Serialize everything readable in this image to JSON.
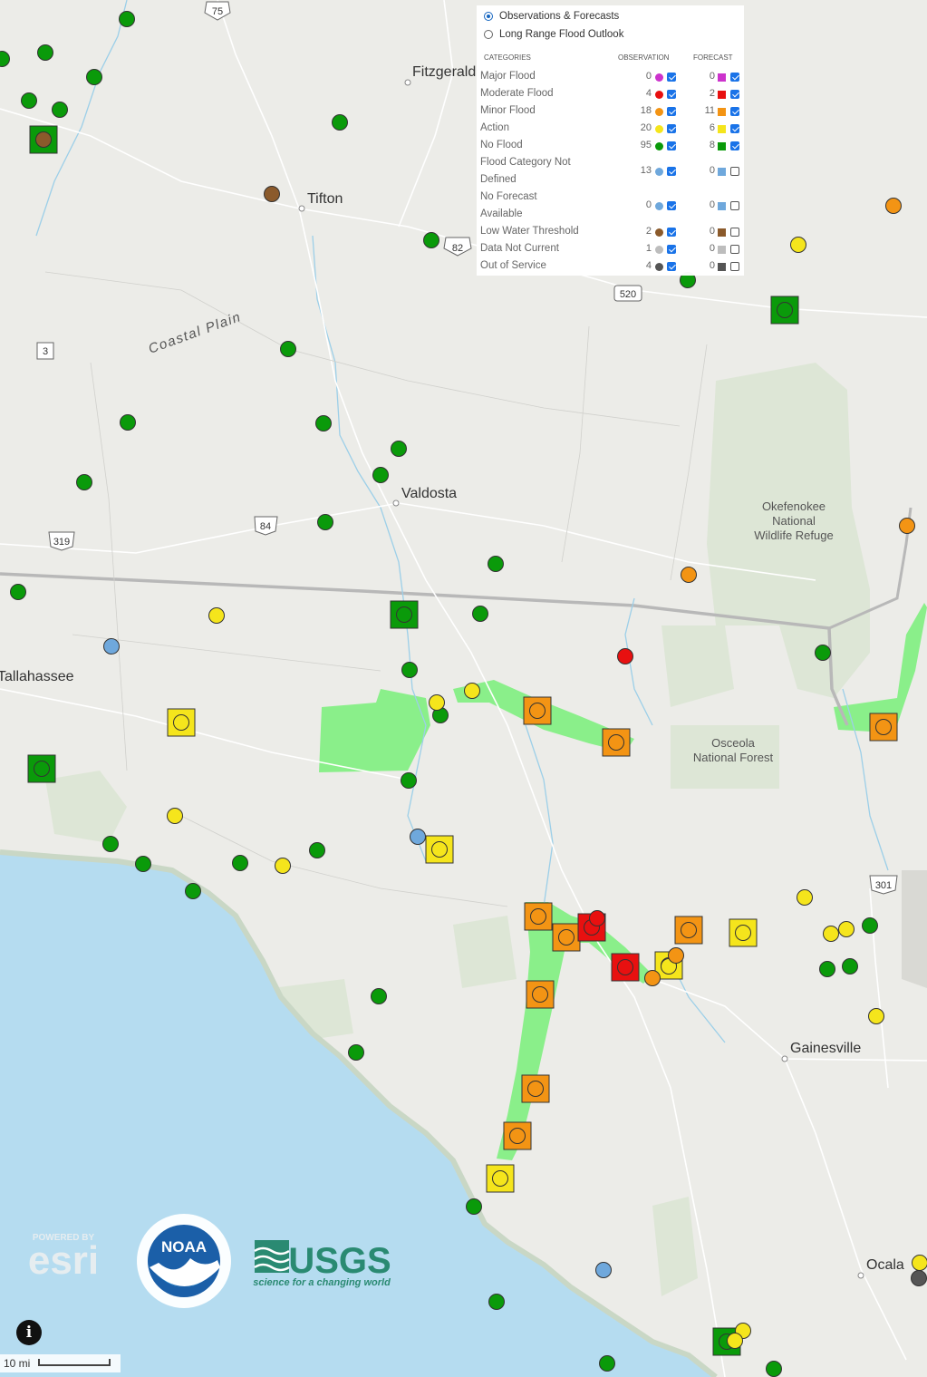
{
  "legend": {
    "modes": [
      {
        "label": "Observations & Forecasts",
        "selected": true
      },
      {
        "label": "Long Range Flood Outlook",
        "selected": false
      }
    ],
    "headers": {
      "categories": "CATEGORIES",
      "observation": "OBSERVATION",
      "forecast": "FORECAST"
    },
    "rows": [
      {
        "label": [
          "Major Flood"
        ],
        "obs": "0",
        "obs_checked": true,
        "fc": "0",
        "fc_checked": true,
        "color": "#cc33cc"
      },
      {
        "label": [
          "Moderate Flood"
        ],
        "obs": "4",
        "obs_checked": true,
        "fc": "2",
        "fc_checked": true,
        "color": "#e81010"
      },
      {
        "label": [
          "Minor Flood"
        ],
        "obs": "18",
        "obs_checked": true,
        "fc": "11",
        "fc_checked": true,
        "color": "#f39414"
      },
      {
        "label": [
          "Action"
        ],
        "obs": "20",
        "obs_checked": true,
        "fc": "6",
        "fc_checked": true,
        "color": "#f5e51c"
      },
      {
        "label": [
          "No Flood"
        ],
        "obs": "95",
        "obs_checked": true,
        "fc": "8",
        "fc_checked": true,
        "color": "#0a9a0a"
      },
      {
        "label": [
          "Flood Category Not",
          "Defined"
        ],
        "obs": "13",
        "obs_checked": true,
        "fc": "0",
        "fc_checked": false,
        "color": "#6fa8dc"
      },
      {
        "label": [
          "No Forecast",
          "Available"
        ],
        "obs": "0",
        "obs_checked": true,
        "fc": "0",
        "fc_checked": false,
        "color": "#6fa8dc"
      },
      {
        "label": [
          "Low Water Threshold"
        ],
        "obs": "2",
        "obs_checked": true,
        "fc": "0",
        "fc_checked": false,
        "color": "#8b5a2b"
      },
      {
        "label": [
          "Data Not Current"
        ],
        "obs": "1",
        "obs_checked": true,
        "fc": "0",
        "fc_checked": false,
        "color": "#bdbdbd"
      },
      {
        "label": [
          "Out of Service"
        ],
        "obs": "4",
        "obs_checked": true,
        "fc": "0",
        "fc_checked": false,
        "color": "#555555"
      }
    ]
  },
  "places": {
    "fitzgerald": "Fitzgerald",
    "tifton": "Tifton",
    "valdosta": "Valdosta",
    "tallahassee": "Tallahassee",
    "gainesville": "Gainesville",
    "ocala": "Ocala",
    "coastal_plain": "Coastal Plain",
    "okefenokee": [
      "Okefenokee",
      "National",
      "Wildlife Refuge"
    ],
    "osceola": [
      "Osceola",
      "National Forest"
    ]
  },
  "shields": {
    "i75": "75",
    "i82": "82",
    "us520": "520",
    "s3": "3",
    "us84": "84",
    "us319": "319",
    "us301": "301"
  },
  "logos": {
    "esri_top": "POWERED BY",
    "esri_main": "esri",
    "noaa": "NOAA",
    "usgs": "USGS",
    "usgs_tag": "science for a changing world"
  },
  "scale": {
    "label": "10 mi"
  },
  "info": {
    "glyph": "i"
  },
  "colors": {
    "no_flood": "#0a9a0a",
    "action": "#f5e51c",
    "minor": "#f39414",
    "moderate": "#e81010",
    "undefined": "#6fa8dc",
    "low_water": "#8b5a2b",
    "water": "#b5dcf0",
    "land": "#ecece8",
    "flood_area": "#80f080"
  },
  "gauges": {
    "circles": [
      {
        "c": "#0a9a0a",
        "p": [
          [
            140,
            21
          ],
          [
            2,
            65
          ],
          [
            50,
            58
          ],
          [
            104,
            85
          ],
          [
            32,
            111
          ],
          [
            66,
            121
          ],
          [
            375,
            135
          ],
          [
            476,
            265
          ],
          [
            759,
            309
          ],
          [
            318,
            385
          ],
          [
            141,
            466
          ],
          [
            357,
            467
          ],
          [
            440,
            495
          ],
          [
            420,
            524
          ],
          [
            93,
            532
          ],
          [
            359,
            576
          ],
          [
            547,
            622
          ],
          [
            20,
            653
          ],
          [
            530,
            677
          ],
          [
            908,
            720
          ],
          [
            452,
            739
          ],
          [
            486,
            789
          ],
          [
            451,
            861
          ],
          [
            122,
            931
          ],
          [
            158,
            953
          ],
          [
            265,
            952
          ],
          [
            350,
            938
          ],
          [
            213,
            983
          ],
          [
            960,
            1021
          ],
          [
            913,
            1069
          ],
          [
            938,
            1066
          ],
          [
            418,
            1099
          ],
          [
            393,
            1161
          ],
          [
            523,
            1331
          ],
          [
            548,
            1436
          ],
          [
            670,
            1504
          ],
          [
            854,
            1510
          ]
        ]
      },
      {
        "c": "#f5e51c",
        "p": [
          [
            881,
            270
          ],
          [
            239,
            679
          ],
          [
            521,
            762
          ],
          [
            482,
            775
          ],
          [
            193,
            900
          ],
          [
            312,
            955
          ],
          [
            888,
            990
          ],
          [
            917,
            1030
          ],
          [
            934,
            1025
          ],
          [
            738,
            1066
          ],
          [
            967,
            1121
          ],
          [
            1015,
            1393
          ],
          [
            820,
            1468
          ],
          [
            811,
            1479
          ]
        ]
      },
      {
        "c": "#f39414",
        "p": [
          [
            986,
            227
          ],
          [
            1001,
            580
          ],
          [
            760,
            634
          ],
          [
            746,
            1054
          ],
          [
            720,
            1079
          ]
        ]
      },
      {
        "c": "#e81010",
        "p": [
          [
            690,
            724
          ],
          [
            659,
            1013
          ]
        ]
      },
      {
        "c": "#6fa8dc",
        "p": [
          [
            123,
            713
          ],
          [
            461,
            923
          ],
          [
            666,
            1401
          ]
        ]
      },
      {
        "c": "#8b5a2b",
        "p": [
          [
            300,
            214
          ]
        ]
      },
      {
        "c": "#555555",
        "p": [
          [
            1014,
            1410
          ]
        ]
      }
    ],
    "squares": [
      {
        "c": "#0a9a0a",
        "inner": "#8b5a2b",
        "p": [
          [
            48,
            154
          ]
        ]
      },
      {
        "c": "#0a9a0a",
        "inner": "#0a9a0a",
        "p": [
          [
            866,
            342
          ],
          [
            446,
            678
          ],
          [
            46,
            848
          ],
          [
            802,
            1480
          ]
        ]
      },
      {
        "c": "#f5e51c",
        "inner": "#f5e51c",
        "p": [
          [
            200,
            797
          ],
          [
            485,
            937
          ],
          [
            820,
            1029
          ],
          [
            738,
            1065
          ],
          [
            552,
            1300
          ]
        ]
      },
      {
        "c": "#f39414",
        "inner": "#f39414",
        "p": [
          [
            593,
            784
          ],
          [
            680,
            819
          ],
          [
            975,
            802
          ],
          [
            594,
            1011
          ],
          [
            625,
            1034
          ],
          [
            760,
            1026
          ],
          [
            596,
            1097
          ],
          [
            591,
            1201
          ],
          [
            571,
            1253
          ]
        ]
      },
      {
        "c": "#e81010",
        "inner": "#e81010",
        "p": [
          [
            653,
            1023
          ],
          [
            690,
            1067
          ]
        ]
      }
    ]
  }
}
